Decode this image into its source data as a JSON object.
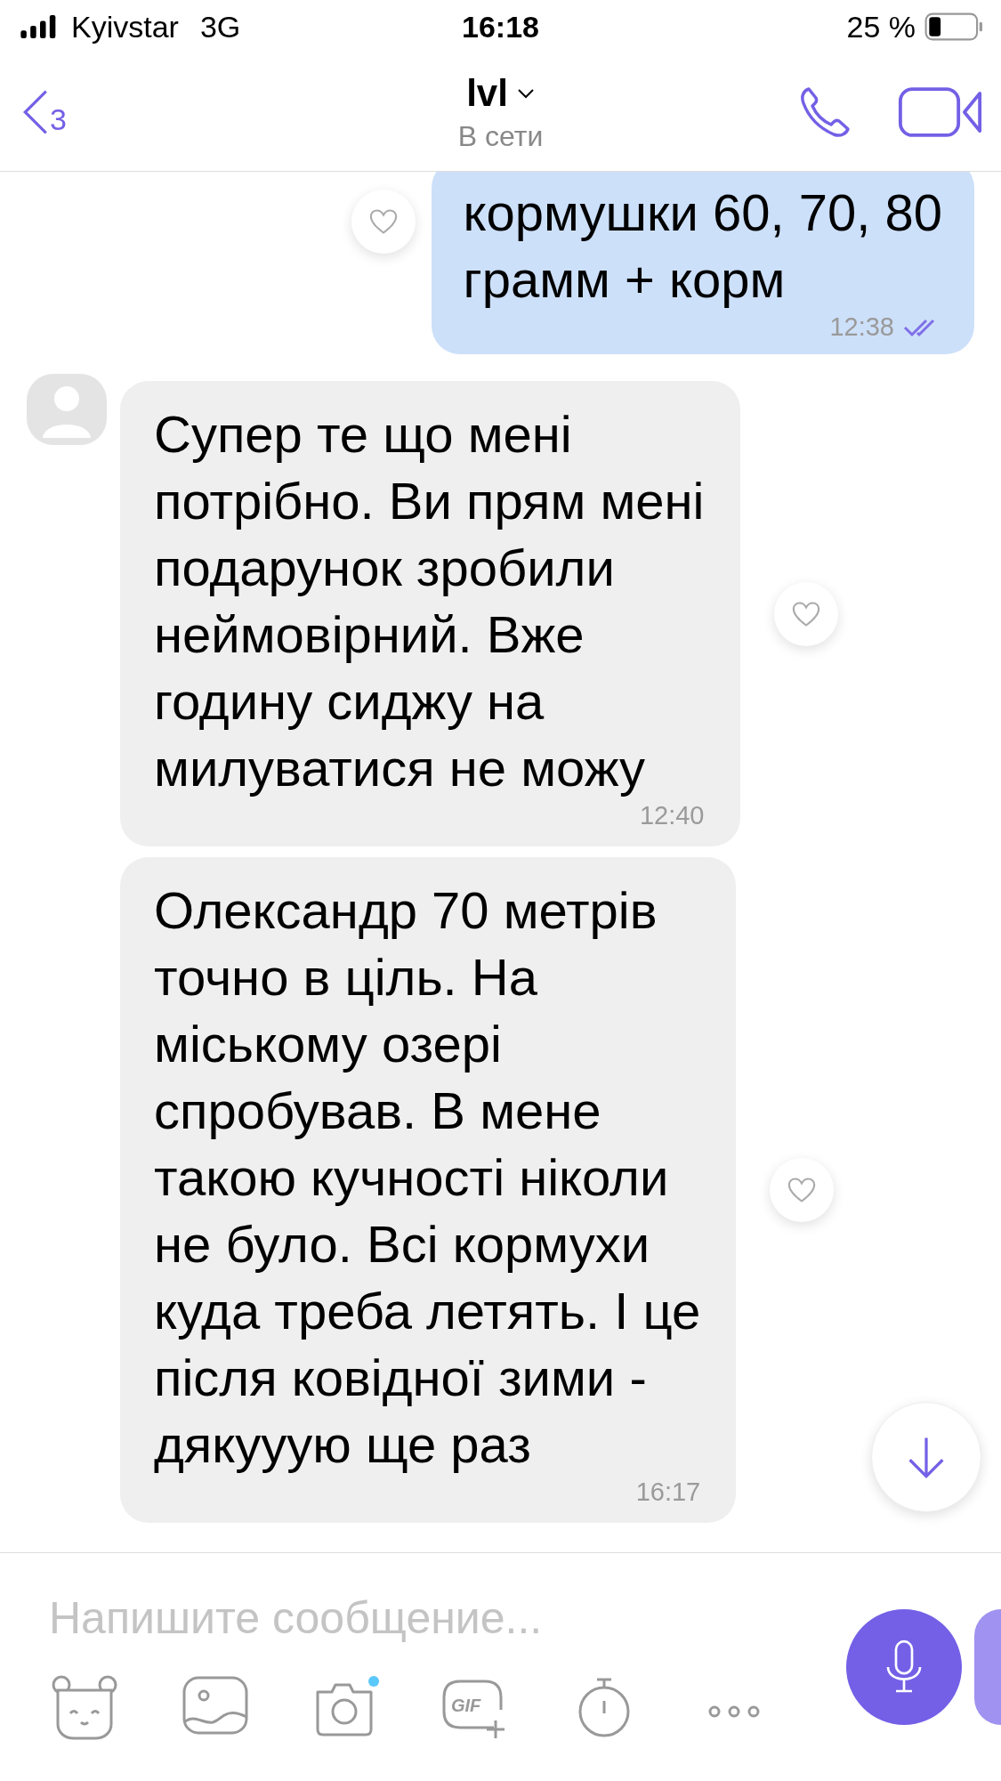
{
  "status_bar": {
    "carrier": "Kyivstar",
    "network": "3G",
    "time": "16:18",
    "battery": "25 %"
  },
  "header": {
    "back_count": "3",
    "title": "lvl",
    "subtitle": "В сети"
  },
  "messages": [
    {
      "kind": "outgoing",
      "lines": [
        "кормушки 60, 70, 80",
        "грамм + корм"
      ],
      "time": "12:38",
      "read": true
    },
    {
      "kind": "incoming",
      "avatar": true,
      "lines": [
        "Супер те що мені",
        "потрібно. Ви прям мені",
        "подарунок зробили",
        "неймовірний. Вже",
        "годину сиджу на",
        "милуватися не можу"
      ],
      "time": "12:40"
    },
    {
      "kind": "incoming",
      "avatar": false,
      "lines": [
        "Олександр 70 метрів",
        "точно в ціль. На",
        "міському озері",
        "спробував. В мене",
        "такою кучності ніколи",
        "не було. Всі кормухи",
        "куда треба летять. І це",
        "після ковідної зими -",
        "дякууую ще раз"
      ],
      "time": "16:17"
    }
  ],
  "composer": {
    "placeholder": "Напишите сообщение..."
  },
  "toolbar": [
    {
      "kind": "sticker"
    },
    {
      "kind": "gallery"
    },
    {
      "kind": "camera",
      "dot": true
    },
    {
      "kind": "gif",
      "label": "GIF"
    },
    {
      "kind": "timer"
    },
    {
      "kind": "more"
    }
  ]
}
